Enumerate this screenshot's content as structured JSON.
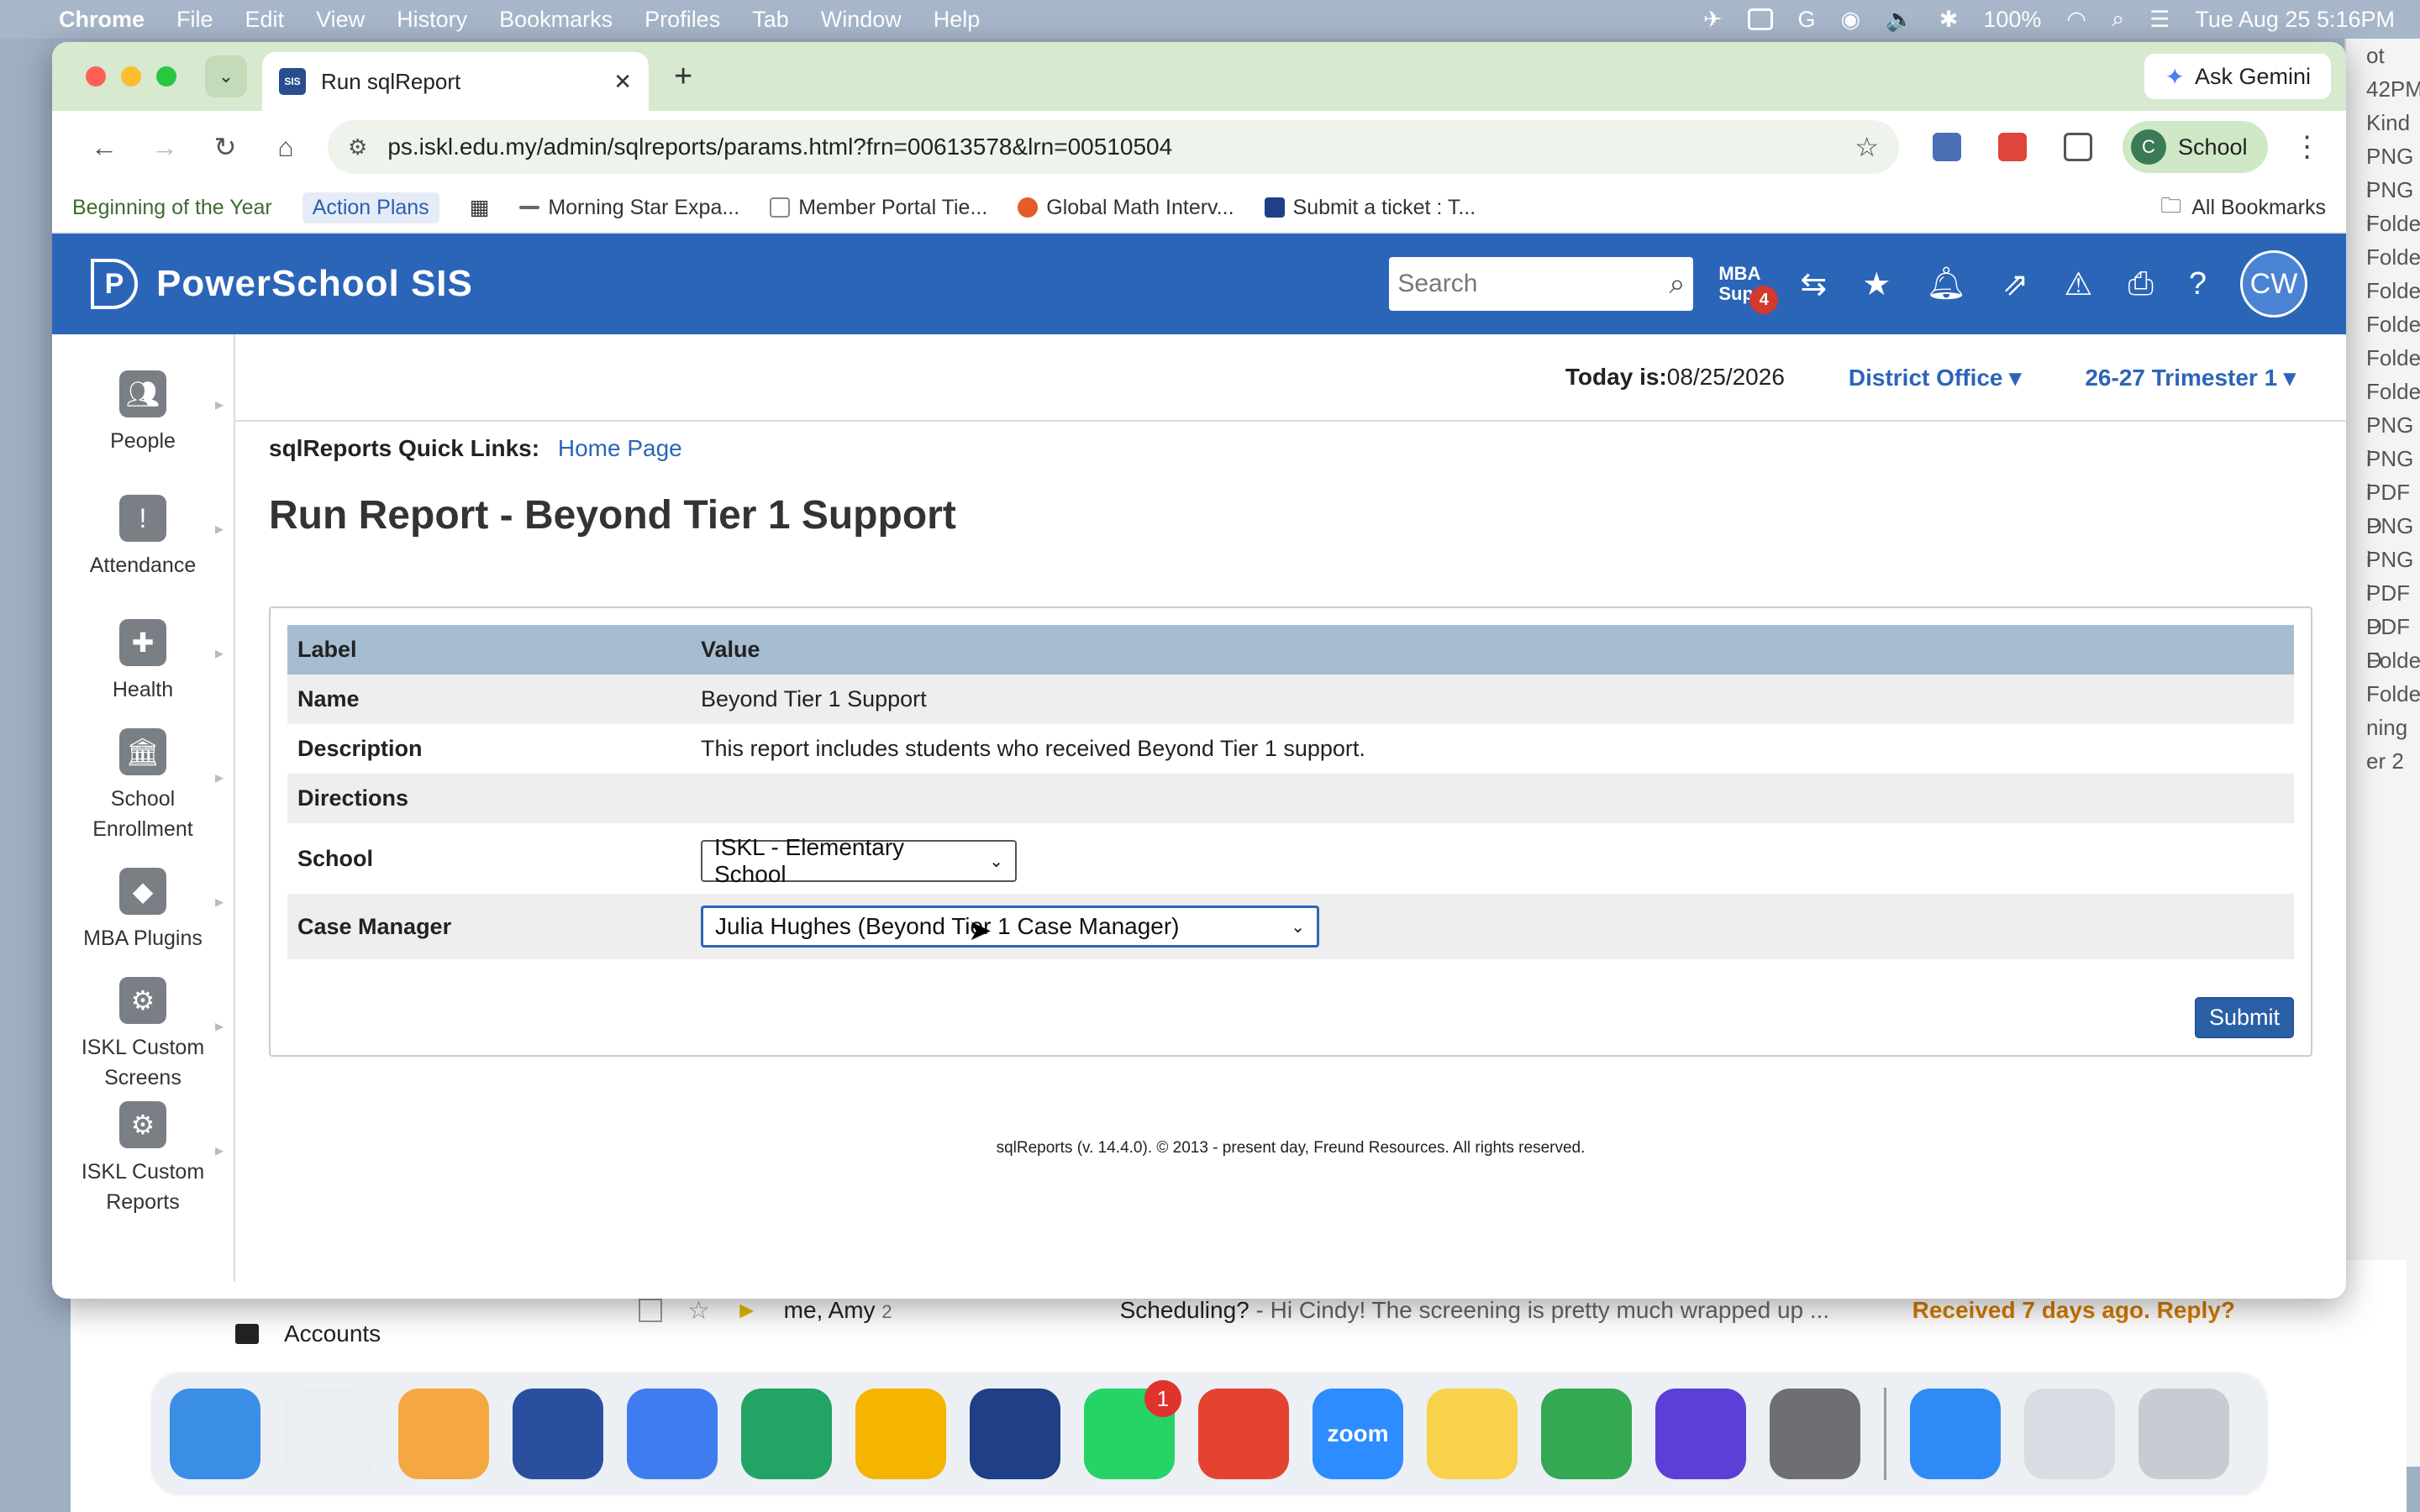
{
  "menubar": {
    "app_name": "Chrome",
    "menus": [
      "File",
      "Edit",
      "View",
      "History",
      "Bookmarks",
      "Profiles",
      "Tab",
      "Window",
      "Help"
    ],
    "battery": "100%",
    "datetime": "Tue Aug 25  5:16PM"
  },
  "browser": {
    "tab_title": "Run sqlReport",
    "favicon_text": "SIS",
    "ask_gemini": "Ask Gemini",
    "url": "ps.iskl.edu.my/admin/sqlreports/params.html?frn=00613578&lrn=00510504",
    "profile_initial": "C",
    "profile_label": "School",
    "bookmarks": [
      "Beginning of the Year",
      "Action Plans",
      "Morning Star Expa...",
      "Member Portal Tie...",
      "Global Math Interv...",
      "Submit a ticket : T..."
    ],
    "all_bookmarks": "All Bookmarks"
  },
  "ps": {
    "brand": "PowerSchool SIS",
    "search_placeholder": "Search",
    "mba_line1": "MBA",
    "mba_line2": "Supp",
    "mba_badge": "4",
    "avatar_initials": "CW",
    "today_label": "Today is:",
    "today_value": "08/25/2026",
    "school_selector": "District Office",
    "term_selector": "26-27 Trimester 1"
  },
  "sidebar": {
    "items": [
      {
        "label": "People"
      },
      {
        "label": "Attendance"
      },
      {
        "label": "Health"
      },
      {
        "label": "School\nEnrollment"
      },
      {
        "label": "MBA Plugins"
      },
      {
        "label": "ISKL Custom\nScreens"
      },
      {
        "label": "ISKL Custom\nReports"
      }
    ]
  },
  "report": {
    "quicklinks_label": "sqlReports Quick Links:",
    "quicklinks_home": "Home Page",
    "title": "Run Report - Beyond Tier 1 Support",
    "col_label": "Label",
    "col_value": "Value",
    "name_label": "Name",
    "name_value": "Beyond Tier 1 Support",
    "desc_label": "Description",
    "desc_value": "This report includes students who received Beyond Tier 1 support.",
    "directions_label": "Directions",
    "school_label": "School",
    "school_value": "ISKL - Elementary School",
    "cm_label": "Case Manager",
    "cm_value": "Julia Hughes (Beyond Tier 1 Case Manager)",
    "submit": "Submit",
    "footer": "sqlReports (v. 14.4.0). © 2013 - present day, Freund Resources. All rights reserved."
  },
  "background": {
    "right_rows": [
      "ot",
      "42PM",
      "Kind",
      "PNG i",
      "PNG i",
      "Folde",
      "Folde",
      "Folde",
      "Folde",
      "Folde",
      "Folde",
      "PNG i",
      "PNG i",
      "PDF D",
      "PNG i",
      "PNG i",
      "PDF D",
      "PDF D",
      "Folde",
      "Folde",
      "ning",
      "er 2"
    ],
    "mail_accounts": "Accounts",
    "mail_from": "me, Amy",
    "mail_count": "2",
    "mail_subject": "Scheduling?",
    "mail_snippet": " - Hi Cindy! The screening is pretty much wrapped up ...",
    "mail_received": "Received 7 days ago. Reply?"
  },
  "dock": {
    "whatsapp_badge": "1",
    "zoom_label": "zoom",
    "colors": [
      "#3a8ee6",
      "#e9eef3",
      "#f5a742",
      "#2b4f9f",
      "#3f7cf0",
      "#21a464",
      "#f4b400",
      "#1f3f86",
      "#25d366",
      "#e44332",
      "#2d8cff",
      "#f7d24a",
      "#34a853",
      "#5b3fd6",
      "#6e6e73",
      "#2f8af5",
      "#d8dde3",
      "#c7ccd2"
    ]
  }
}
